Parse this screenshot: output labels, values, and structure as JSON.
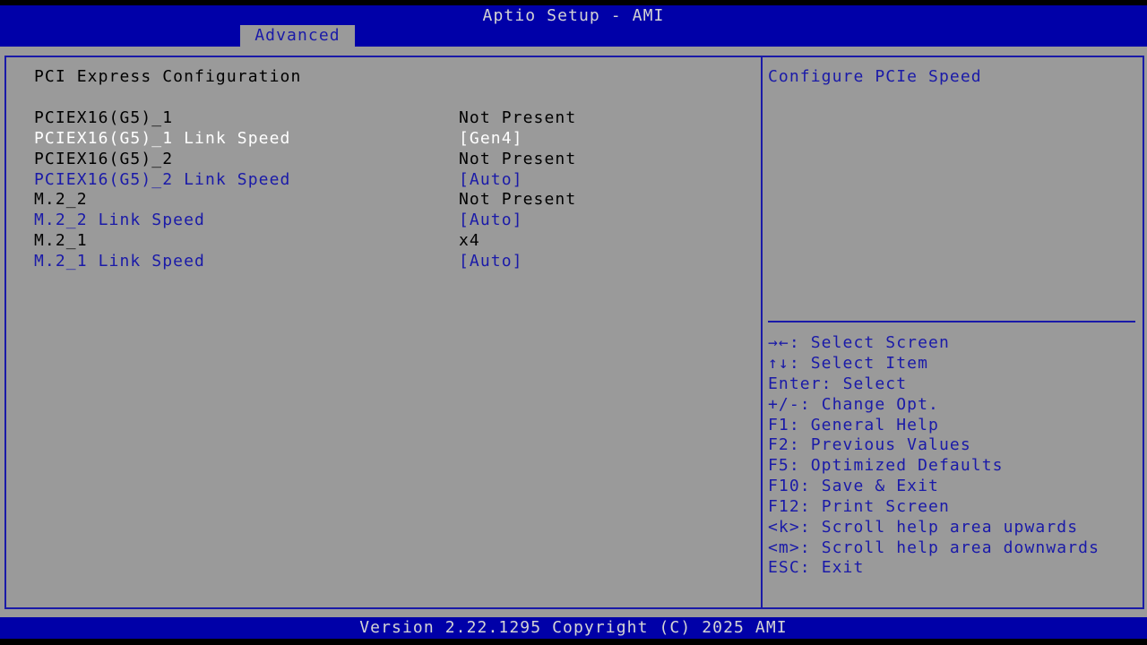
{
  "header": {
    "title": "Aptio Setup - AMI",
    "active_tab": "Advanced"
  },
  "main": {
    "section_title": "PCI Express Configuration",
    "items": [
      {
        "label": "PCIEX16(G5)_1",
        "value": "Not Present",
        "kind": "info"
      },
      {
        "label": "PCIEX16(G5)_1 Link Speed",
        "value": "[Gen4]",
        "kind": "selected"
      },
      {
        "label": "PCIEX16(G5)_2",
        "value": "Not Present",
        "kind": "info"
      },
      {
        "label": "PCIEX16(G5)_2 Link Speed",
        "value": "[Auto]",
        "kind": "setting"
      },
      {
        "label": "M.2_2",
        "value": "Not Present",
        "kind": "info"
      },
      {
        "label": "M.2_2 Link Speed",
        "value": "[Auto]",
        "kind": "setting"
      },
      {
        "label": "M.2_1",
        "value": "x4",
        "kind": "info"
      },
      {
        "label": "M.2_1 Link Speed",
        "value": "[Auto]",
        "kind": "setting"
      }
    ]
  },
  "help": {
    "description": "Configure PCIe Speed",
    "keys": [
      {
        "key": "→←:",
        "action": "Select Screen"
      },
      {
        "key": "↑↓:",
        "action": "Select Item"
      },
      {
        "key": "Enter:",
        "action": "Select"
      },
      {
        "key": "+/-:",
        "action": "Change Opt."
      },
      {
        "key": "F1:",
        "action": "General Help"
      },
      {
        "key": "F2:",
        "action": "Previous Values"
      },
      {
        "key": "F5:",
        "action": "Optimized Defaults"
      },
      {
        "key": "F10:",
        "action": "Save & Exit"
      },
      {
        "key": "F12:",
        "action": "Print Screen"
      },
      {
        "key": "<k>:",
        "action": "Scroll help area upwards"
      },
      {
        "key": "<m>:",
        "action": "Scroll help area downwards"
      },
      {
        "key": "ESC:",
        "action": "Exit"
      }
    ]
  },
  "footer": {
    "version": "Version 2.22.1295 Copyright (C) 2025 AMI"
  },
  "colors": {
    "bar_blue": "#0000a8",
    "panel_gray": "#9a9a9a",
    "setting_blue": "#1a1aa8",
    "selected_white": "#ffffff",
    "info_black": "#000000"
  }
}
